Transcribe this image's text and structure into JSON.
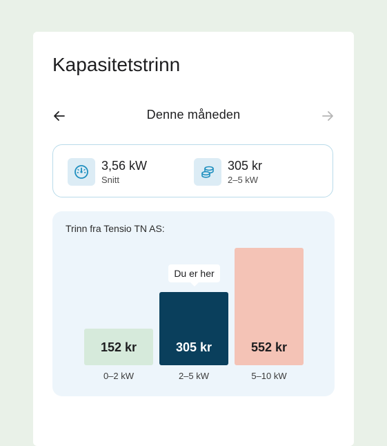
{
  "page": {
    "title": "Kapasitetstrinn"
  },
  "nav": {
    "period_label": "Denne måneden",
    "prev_icon": "arrow-left-icon",
    "next_icon": "arrow-right-icon",
    "next_disabled": true
  },
  "summary": {
    "average": {
      "value": "3,56 kW",
      "sub": "Snitt",
      "icon": "gauge-icon"
    },
    "price": {
      "value": "305 kr",
      "sub": "2–5 kW",
      "icon": "coins-icon"
    }
  },
  "tiers": {
    "label": "Trinn fra Tensio TN AS:",
    "tooltip": "Du er her",
    "active_index": 1,
    "items": [
      {
        "value": "152 kr",
        "range": "0–2 kW",
        "color": "#d6eadb",
        "text_color": "#1d1d1f"
      },
      {
        "value": "305 kr",
        "range": "2–5 kW",
        "color": "#0a3f5c",
        "text_color": "#ffffff"
      },
      {
        "value": "552 kr",
        "range": "5–10 kW",
        "color": "#f4c3b6",
        "text_color": "#1d1d1f"
      }
    ]
  },
  "colors": {
    "background": "#e9f1e8",
    "accent_icon": "#1f8fbf",
    "icon_bg": "#dcecf5",
    "card_border": "#b9dbea",
    "tier_panel": "#edf5fb"
  }
}
